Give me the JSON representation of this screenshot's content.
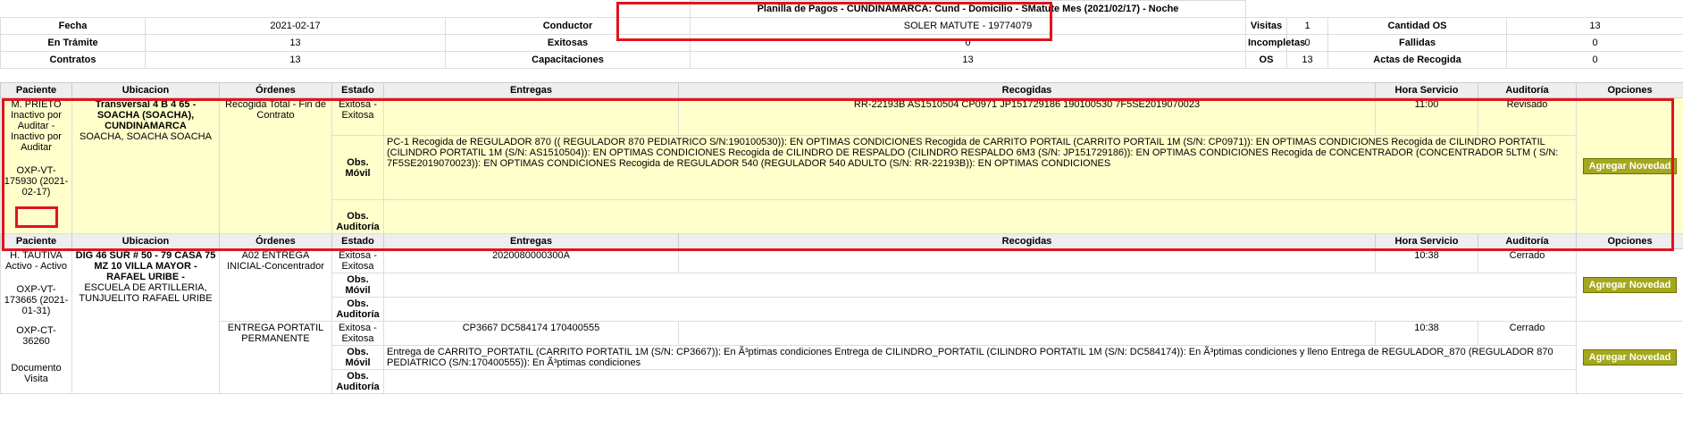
{
  "summary": {
    "title": "Planilla de Pagos - CUNDINAMARCA: Cund - Domicilio - SMatute Mes (2021/02/17) - Noche",
    "rows": [
      [
        {
          "l": "Fecha",
          "v": "2021-02-17"
        },
        {
          "l": "Conductor",
          "v": "SOLER MATUTE - 19774079"
        },
        {
          "l": "Visitas",
          "v": "1"
        },
        {
          "l": "Cantidad OS",
          "v": "13"
        }
      ],
      [
        {
          "l": "En Trámite",
          "v": "13"
        },
        {
          "l": "Exitosas",
          "v": "0"
        },
        {
          "l": "Incompletas",
          "v": "0"
        },
        {
          "l": "Fallidas",
          "v": "0"
        }
      ],
      [
        {
          "l": "Contratos",
          "v": "13"
        },
        {
          "l": "Capacitaciones",
          "v": "13"
        },
        {
          "l": "OS",
          "v": "13"
        },
        {
          "l": "Actas de Recogida",
          "v": "0"
        }
      ]
    ]
  },
  "headers": [
    "Paciente",
    "Ubicacion",
    "Órdenes",
    "Estado",
    "Entregas",
    "Recogidas",
    "Hora Servicio",
    "Auditoría",
    "Opciones"
  ],
  "button_label": "Agregar Novedad",
  "obs_movil": "Obs. Móvil",
  "obs_auditoria": "Obs. Auditoría",
  "record1": {
    "paciente_name": "M. PRIETO",
    "paciente_status": "Inactivo por Auditar - Inactivo por Auditar",
    "paciente_code": "OXP-VT-175930 (2021-02-17)",
    "ubicacion_bold": "Transversal 4 B 4 65 - SOACHA (SOACHA), CUNDINAMARCA",
    "ubicacion_rest": "SOACHA, SOACHA SOACHA",
    "orden": "Recogida Total - Fin de Contrato",
    "estado": "Exitosa - Exitosa",
    "entregas": "",
    "recogidas": "RR-22193B AS1510504 CP0971 JP151729186 190100530 7F5SE2019070023",
    "hora": "11:00",
    "auditoria": "Revisado",
    "obs_movil_text": "PC-1 Recogida de REGULADOR 870 (( REGULADOR 870 PEDIATRICO S/N:190100530)): EN OPTIMAS CONDICIONES Recogida de CARRITO PORTAIL (CARRITO PORTAIL 1M (S/N: CP0971)): EN OPTIMAS CONDICIONES Recogida de CILINDRO PORTATIL (CILINDRO PORTATIL 1M (S/N: AS1510504)): EN OPTIMAS CONDICIONES Recogida de CILINDRO DE RESPALDO (CILINDRO RESPALDO 6M3 (S/N: JP151729186)): EN OPTIMAS CONDICIONES Recogida de CONCENTRADOR (CONCENTRADOR 5LTM ( S/N: 7F5SE2019070023)): EN OPTIMAS CONDICIONES Recogida de REGULADOR 540 (REGULADOR 540 ADULTO (S/N: RR-22193B)): EN OPTIMAS CONDICIONES",
    "obs_auditoria_text": ""
  },
  "record2": {
    "paciente_name": "H. TAUTIVA",
    "paciente_status": "Activo - Activo",
    "paciente_code": "OXP-VT-173665 (2021-01-31)",
    "paciente_ct": "OXP-CT-36260",
    "paciente_doc": "Documento Visita",
    "ubicacion_bold": "DIG 46 SUR # 50 - 79 CASA 75 MZ 10 VILLA MAYOR - RAFAEL URIBE -",
    "ubicacion_rest": "ESCUELA DE ARTILLERIA, TUNJUELITO RAFAEL URIBE",
    "orders": [
      {
        "orden": "A02 ENTREGA INICIAL-Concentrador",
        "estado": "Exitosa - Exitosa",
        "entregas": "2020080000300A",
        "recogidas": "",
        "hora": "10:38",
        "auditoria": "Cerrado",
        "obs_movil_text": "",
        "obs_auditoria_text": ""
      },
      {
        "orden": "ENTREGA PORTATIL PERMANENTE",
        "estado": "Exitosa - Exitosa",
        "entregas": "CP3667 DC584174 170400555",
        "recogidas": "",
        "hora": "10:38",
        "auditoria": "Cerrado",
        "obs_movil_text": "Entrega de CARRITO_PORTATIL (CARRITO PORTATIL 1M (S/N: CP3667)): En Ã³ptimas condiciones Entrega de CILINDRO_PORTATIL (CILINDRO PORTATIL 1M (S/N: DC584174)): En Ã³ptimas condiciones y lleno Entrega de REGULADOR_870 (REGULADOR 870 PEDIATRICO (S/N:170400555)): En Ã³ptimas condiciones",
        "obs_auditoria_text": ""
      }
    ]
  }
}
